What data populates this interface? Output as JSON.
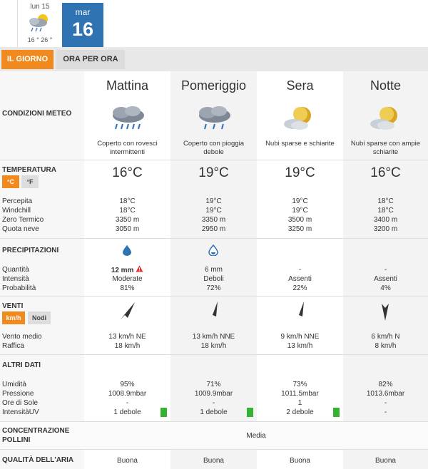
{
  "days": [
    {
      "label": "lun 15",
      "temps": "16 ° 26 °",
      "icon": "rain-cloud-sun-icon"
    },
    {
      "label": "mar",
      "num": "16"
    }
  ],
  "tabs": {
    "day": "IL GIORNO",
    "hourly": "ORA PER ORA"
  },
  "columns": [
    "Mattina",
    "Pomeriggio",
    "Sera",
    "Notte"
  ],
  "conditions": {
    "label": "CONDIZIONI METEO",
    "descs": [
      "Coperto con rovesci intermittenti",
      "Coperto con pioggia debole",
      "Nubi sparse e schiarite",
      "Nubi sparse con ampie schiarite"
    ],
    "icons": [
      "heavy-rain-icon",
      "light-rain-icon",
      "partly-cloudy-night-icon",
      "partly-cloudy-night-icon"
    ]
  },
  "temperature": {
    "label": "TEMPERATURA",
    "unit_c": "°C",
    "unit_f": "°F",
    "values": [
      "16°C",
      "19°C",
      "19°C",
      "16°C"
    ],
    "row_labels": [
      "Percepita",
      "Windchill",
      "Zero Termico",
      "Quota neve"
    ],
    "rows": [
      [
        "18°C",
        "18°C",
        "3350 m",
        "3050 m"
      ],
      [
        "19°C",
        "19°C",
        "3350 m",
        "2950 m"
      ],
      [
        "19°C",
        "19°C",
        "3500 m",
        "3250 m"
      ],
      [
        "18°C",
        "18°C",
        "3400 m",
        "3200 m"
      ]
    ]
  },
  "precip": {
    "label": "PRECIPITAZIONI",
    "row_labels": [
      "Quantità",
      "Intensità",
      "Probabilità"
    ],
    "rows": [
      [
        "12 mm",
        "Moderate",
        "81%"
      ],
      [
        "6 mm",
        "Deboli",
        "72%"
      ],
      [
        "-",
        "Assenti",
        "22%"
      ],
      [
        "-",
        "Assenti",
        "4%"
      ]
    ]
  },
  "wind": {
    "label": "VENTI",
    "unit_kmh": "km/h",
    "unit_knots": "Nodi",
    "row_labels": [
      "Vento medio",
      "Raffica"
    ],
    "rows": [
      [
        "13 km/h  NE",
        "18 km/h"
      ],
      [
        "13 km/h NNE",
        "18 km/h"
      ],
      [
        "9 km/h NNE",
        "13 km/h"
      ],
      [
        "6 km/h N",
        "8 km/h"
      ]
    ]
  },
  "other": {
    "label": "ALTRI DATI",
    "row_labels": [
      "Umidità",
      "Pressione",
      "Ore di Sole",
      "IntensitàUV"
    ],
    "rows": [
      [
        "95%",
        "1008.9mbar",
        "-",
        "1 debole"
      ],
      [
        "71%",
        "1009.9mbar",
        "-",
        "1 debole"
      ],
      [
        "73%",
        "1011.5mbar",
        "1",
        "2 debole"
      ],
      [
        "82%",
        "1013.6mbar",
        "-",
        "-"
      ]
    ]
  },
  "pollen": {
    "label_l1": "CONCENTRAZIONE",
    "label_l2": "POLLINI",
    "value": "Media"
  },
  "air": {
    "label": "QUALITÀ DELL'ARIA",
    "values": [
      "Buona",
      "Buona",
      "Buona",
      "Buona"
    ]
  },
  "colors": {
    "accent": "#f08a1e",
    "selected_day": "#2f73b3",
    "uv_low": "#34b233",
    "warning": "#e03030"
  }
}
